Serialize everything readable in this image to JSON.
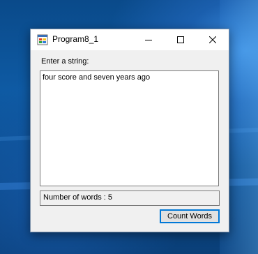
{
  "window": {
    "title": "Program8_1",
    "icon": "windows-forms-app-icon"
  },
  "controls": {
    "minimize_icon": "minimize-icon",
    "maximize_icon": "maximize-icon",
    "close_icon": "close-icon"
  },
  "form": {
    "prompt_label": "Enter a string:",
    "input_value": "four score and seven years ago",
    "result_text": "Number of words : 5",
    "count_button_label": "Count Words"
  },
  "colors": {
    "accent": "#0078d7",
    "window_bg": "#f0f0f0",
    "desktop_bg": "#0b3f74"
  }
}
